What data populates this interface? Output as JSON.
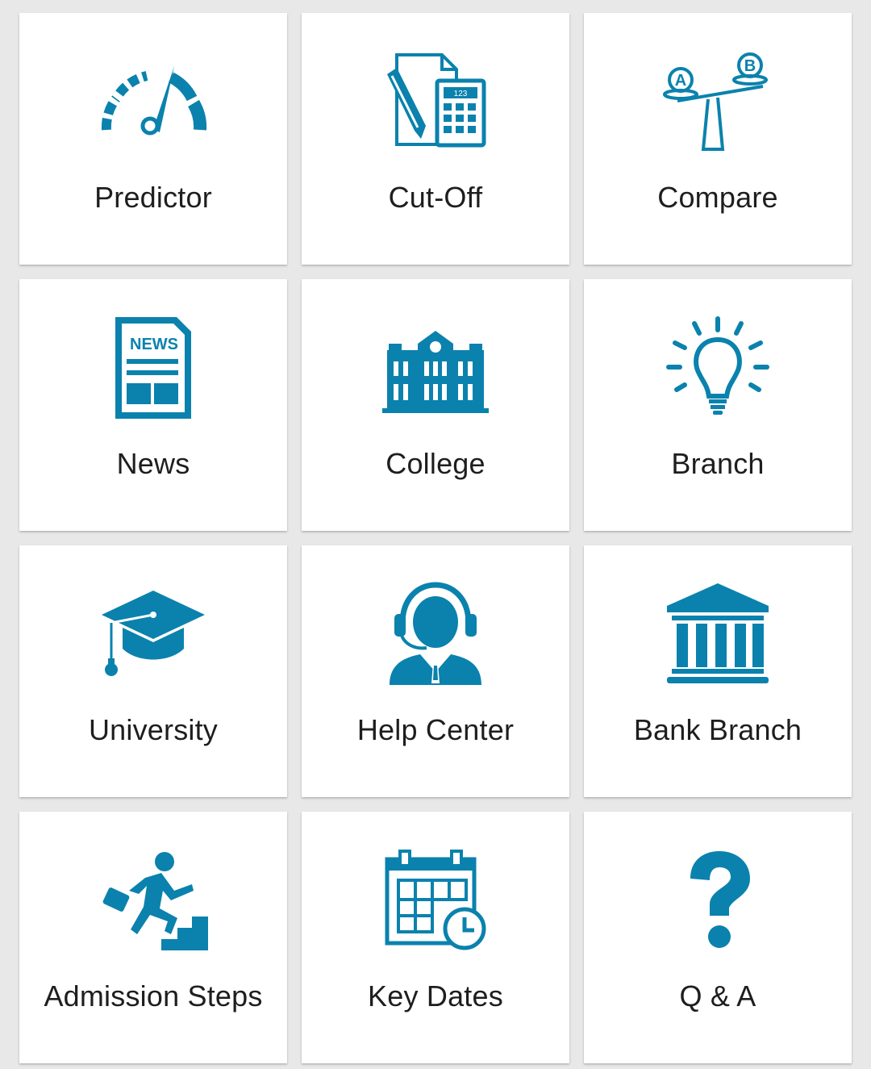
{
  "accent_color": "#0a82ad",
  "tiles": [
    {
      "label": "Predictor",
      "icon": "speedometer-icon"
    },
    {
      "label": "Cut-Off",
      "icon": "document-calculator-icon"
    },
    {
      "label": "Compare",
      "icon": "balance-scale-icon"
    },
    {
      "label": "News",
      "icon": "newspaper-icon"
    },
    {
      "label": "College",
      "icon": "college-building-icon"
    },
    {
      "label": "Branch",
      "icon": "lightbulb-icon"
    },
    {
      "label": "University",
      "icon": "graduation-cap-icon"
    },
    {
      "label": "Help Center",
      "icon": "headset-agent-icon"
    },
    {
      "label": "Bank Branch",
      "icon": "bank-building-icon"
    },
    {
      "label": "Admission Steps",
      "icon": "climbing-steps-icon"
    },
    {
      "label": "Key Dates",
      "icon": "calendar-clock-icon"
    },
    {
      "label": "Q & A",
      "icon": "question-mark-icon"
    }
  ],
  "icon_labels": {
    "news_badge": "NEWS",
    "calculator_display": "123",
    "scale_left": "A",
    "scale_right": "B"
  }
}
